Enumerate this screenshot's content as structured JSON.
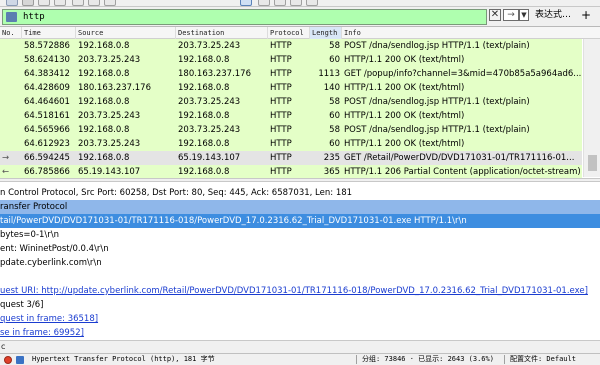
{
  "filter": {
    "value": "http"
  },
  "toolbar": {
    "expression_label": "表达式…",
    "add_label": "+",
    "apply_label": "→",
    "clear_label": "✕"
  },
  "packet_list": {
    "columns": [
      "No.",
      "Time",
      "Source",
      "Destination",
      "Protocol",
      "Length",
      "Info"
    ],
    "rows": [
      {
        "time": "58.572886",
        "source": "192.168.0.8",
        "destination": "203.73.25.243",
        "protocol": "HTTP",
        "length": "58",
        "info": "POST /dna/sendlog.jsp HTTP/1.1  (text/plain)",
        "style": "green"
      },
      {
        "time": "58.624130",
        "source": "203.73.25.243",
        "destination": "192.168.0.8",
        "protocol": "HTTP",
        "length": "60",
        "info": "HTTP/1.1 200 OK  (text/html)",
        "style": "green"
      },
      {
        "time": "64.383412",
        "source": "192.168.0.8",
        "destination": "180.163.237.176",
        "protocol": "HTTP",
        "length": "1113",
        "info": "GET /popup/info?channel=3&mid=470b85a5a964ad6...",
        "style": "green"
      },
      {
        "time": "64.428609",
        "source": "180.163.237.176",
        "destination": "192.168.0.8",
        "protocol": "HTTP",
        "length": "140",
        "info": "HTTP/1.1 200 OK  (text/html)",
        "style": "green"
      },
      {
        "time": "64.464601",
        "source": "192.168.0.8",
        "destination": "203.73.25.243",
        "protocol": "HTTP",
        "length": "58",
        "info": "POST /dna/sendlog.jsp HTTP/1.1  (text/plain)",
        "style": "green"
      },
      {
        "time": "64.518161",
        "source": "203.73.25.243",
        "destination": "192.168.0.8",
        "protocol": "HTTP",
        "length": "60",
        "info": "HTTP/1.1 200 OK  (text/html)",
        "style": "green"
      },
      {
        "time": "64.565966",
        "source": "192.168.0.8",
        "destination": "203.73.25.243",
        "protocol": "HTTP",
        "length": "58",
        "info": "POST /dna/sendlog.jsp HTTP/1.1  (text/plain)",
        "style": "green"
      },
      {
        "time": "64.612923",
        "source": "203.73.25.243",
        "destination": "192.168.0.8",
        "protocol": "HTTP",
        "length": "60",
        "info": "HTTP/1.1 200 OK  (text/html)",
        "style": "green"
      },
      {
        "time": "66.594245",
        "source": "192.168.0.8",
        "destination": "65.19.143.107",
        "protocol": "HTTP",
        "length": "235",
        "info": "GET /Retail/PowerDVD/DVD171031-01/TR171116-01...",
        "style": "selected"
      },
      {
        "time": "66.785866",
        "source": "65.19.143.107",
        "destination": "192.168.0.8",
        "protocol": "HTTP",
        "length": "365",
        "info": "HTTP/1.1 206 Partial Content  (application/octet-stream)",
        "style": "green"
      }
    ]
  },
  "details": {
    "lines": [
      {
        "text": "n Control Protocol, Src Port: 60258, Dst Port: 80, Seq: 445, Ack: 6587031, Len: 181",
        "style": ""
      },
      {
        "text": "ransfer Protocol",
        "style": "hl1"
      },
      {
        "text": "tail/PowerDVD/DVD171031-01/TR171116-018/PowerDVD_17.0.2316.62_Trial_DVD171031-01.exe HTTP/1.1\\r\\n",
        "style": "hl2"
      },
      {
        "text": "bytes=0-1\\r\\n",
        "style": ""
      },
      {
        "text": "ent: WininetPost/0.0.4\\r\\n",
        "style": ""
      },
      {
        "text": "pdate.cyberlink.com\\r\\n",
        "style": ""
      },
      {
        "text": "",
        "style": ""
      },
      {
        "text": "uest URI: http://update.cyberlink.com/Retail/PowerDVD/DVD171031-01/TR171116-018/PowerDVD_17.0.2316.62_Trial_DVD171031-01.exe]",
        "style": "link"
      },
      {
        "text": "quest 3/6]",
        "style": ""
      },
      {
        "text": "quest in frame: 36518]",
        "style": "link"
      },
      {
        "text": "se in frame: 69952]",
        "style": "link"
      }
    ],
    "footer": "c"
  },
  "status": {
    "protocol_text": "Hypertext Transfer Protocol (http), 181 字节",
    "packets_text": "分组: 73846 · 已显示: 2643 (3.6%)",
    "profile_text": "配置文件: Default"
  },
  "colors": {
    "filter_ok": "#afffaf",
    "http_row": "#e4ffc7",
    "selected_row": "#e4e4e4",
    "detail_highlight": "#3d8de0"
  }
}
